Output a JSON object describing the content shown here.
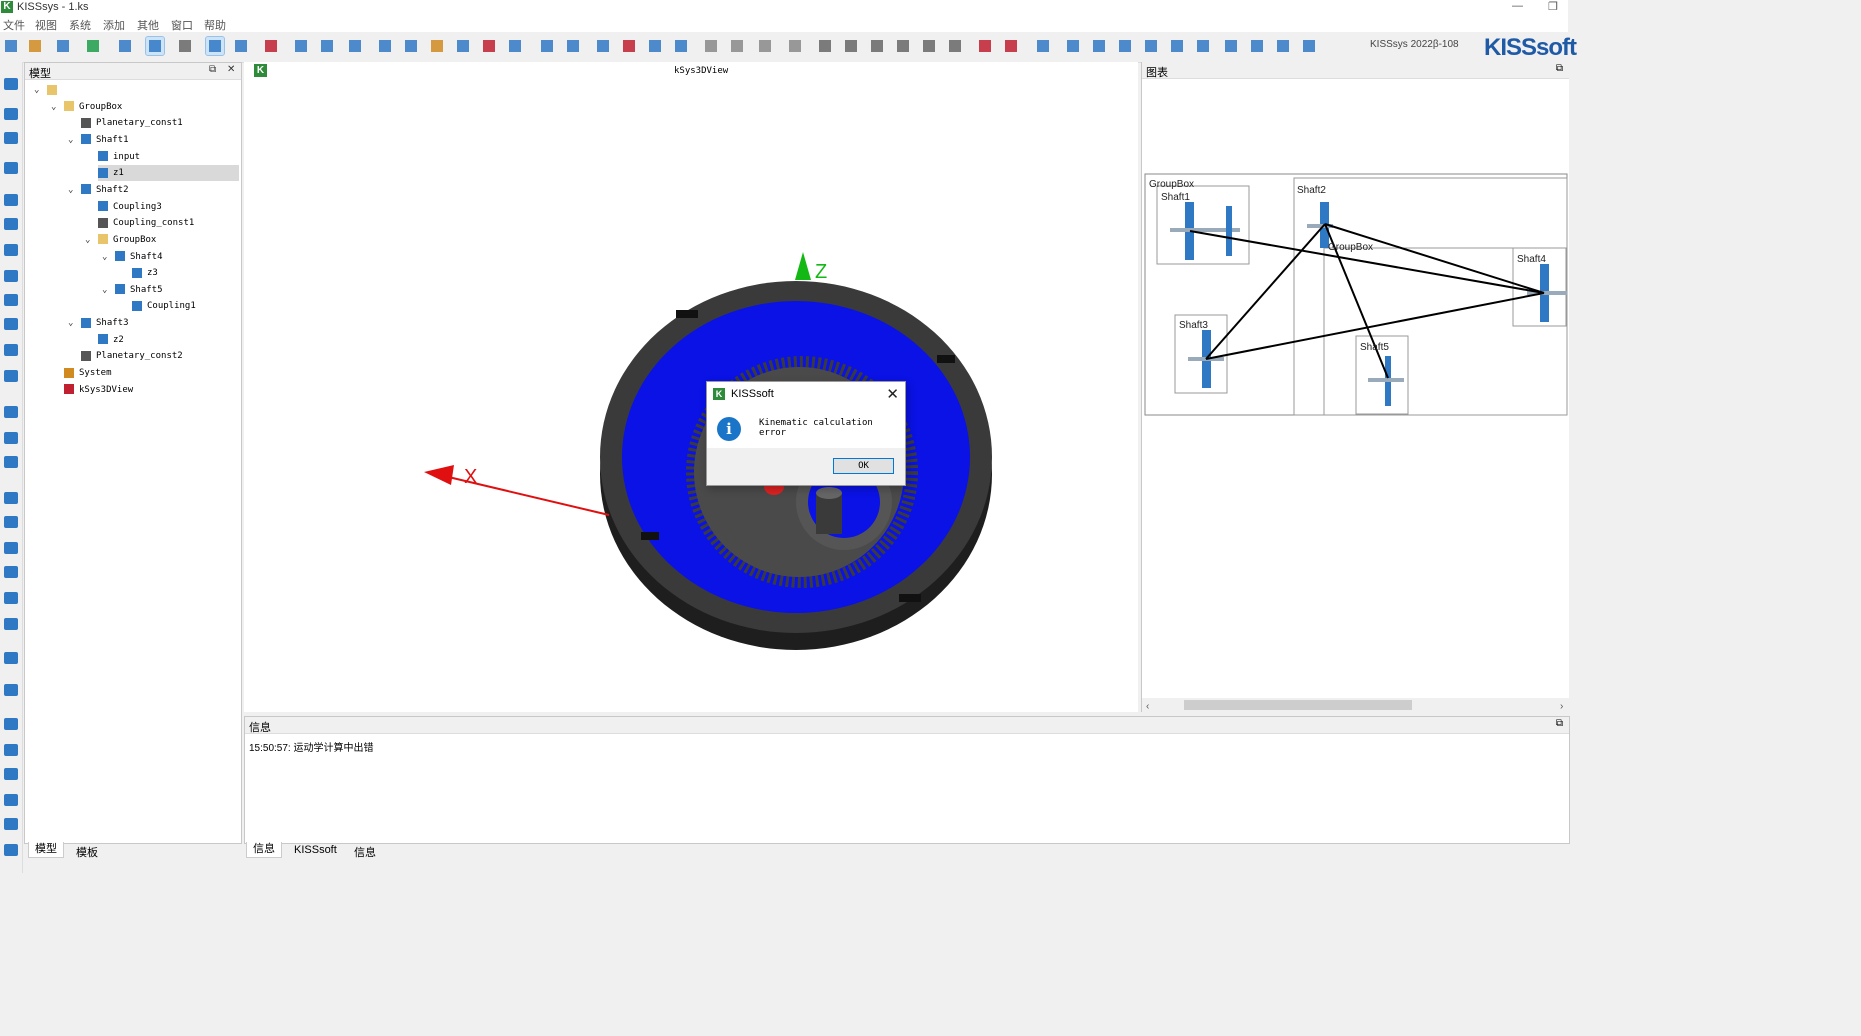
{
  "window": {
    "title": "KISSsys - 1.ks",
    "logo_letter": "K",
    "min": "—",
    "restore": "❐"
  },
  "menu": [
    "文件",
    "视图",
    "系统",
    "添加",
    "其他",
    "窗口",
    "帮助"
  ],
  "toolbar": {
    "version": "KISSsys 2022β-108",
    "logo": "KISSsoft"
  },
  "model_panel": {
    "title": "模型",
    "pin": "⧉",
    "close": "✕",
    "tree": [
      {
        "label": "",
        "depth": 0,
        "chev": "v",
        "icon": "folder-open-icon"
      },
      {
        "label": "GroupBox",
        "depth": 1,
        "chev": "v",
        "icon": "folder-icon"
      },
      {
        "label": "Planetary_const1",
        "depth": 2,
        "chev": "",
        "icon": "constraint-icon"
      },
      {
        "label": "Shaft1",
        "depth": 2,
        "chev": "v",
        "icon": "shaft-icon"
      },
      {
        "label": "input",
        "depth": 3,
        "chev": "",
        "icon": "coupling-icon"
      },
      {
        "label": "z1",
        "depth": 3,
        "chev": "",
        "icon": "gear-icon",
        "selected": true
      },
      {
        "label": "Shaft2",
        "depth": 2,
        "chev": "v",
        "icon": "shaft-icon"
      },
      {
        "label": "Coupling3",
        "depth": 3,
        "chev": "",
        "icon": "coupling-icon"
      },
      {
        "label": "Coupling_const1",
        "depth": 3,
        "chev": "",
        "icon": "constraint-icon"
      },
      {
        "label": "GroupBox",
        "depth": 3,
        "chev": "v",
        "icon": "folder-icon"
      },
      {
        "label": "Shaft4",
        "depth": 4,
        "chev": "v",
        "icon": "shaft-icon"
      },
      {
        "label": "z3",
        "depth": 5,
        "chev": "",
        "icon": "gear-icon"
      },
      {
        "label": "Shaft5",
        "depth": 4,
        "chev": "v",
        "icon": "shaft-icon"
      },
      {
        "label": "Coupling1",
        "depth": 5,
        "chev": "",
        "icon": "coupling-icon"
      },
      {
        "label": "Shaft3",
        "depth": 2,
        "chev": "v",
        "icon": "shaft-icon"
      },
      {
        "label": "z2",
        "depth": 3,
        "chev": "",
        "icon": "gear-icon"
      },
      {
        "label": "Planetary_const2",
        "depth": 2,
        "chev": "",
        "icon": "constraint-icon"
      },
      {
        "label": "System",
        "depth": 1,
        "chev": "",
        "icon": "system-icon"
      },
      {
        "label": "kSys3DView",
        "depth": 1,
        "chev": "",
        "icon": "eye-icon"
      }
    ],
    "tabs": [
      "模型",
      "模板"
    ]
  },
  "view3d": {
    "title": "kSys3DView",
    "axis_x": "X",
    "axis_z": "Z",
    "colors": {
      "ring": "#3a3a3a",
      "carrier": "#0a12e6",
      "axis_x": "#e01010",
      "axis_z": "#14b814"
    }
  },
  "dialog": {
    "title": "KISSsoft",
    "message": "Kinematic calculation error",
    "ok": "OK",
    "close": "✕",
    "info_glyph": "i"
  },
  "diagram": {
    "title": "图表",
    "pin": "⧉",
    "labels": {
      "groupbox_outer": "GroupBox",
      "shaft1": "Shaft1",
      "shaft2": "Shaft2",
      "groupbox_inner": "GroupBox",
      "shaft4": "Shaft4",
      "shaft3": "Shaft3",
      "shaft5": "Shaft5"
    }
  },
  "info_panel": {
    "title": "信息",
    "pin": "⧉",
    "log": "15:50:57: 运动学计算中出错",
    "tabs": [
      "信息",
      "KISSsoft",
      "信息"
    ]
  }
}
